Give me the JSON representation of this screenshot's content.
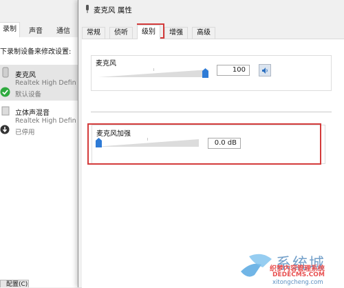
{
  "background_dialog": {
    "tabs": [
      {
        "label": "录制",
        "active": true
      },
      {
        "label": "声音",
        "active": false
      },
      {
        "label": "通信",
        "active": false
      }
    ],
    "instruction": "下录制设备来修改设置:",
    "devices": [
      {
        "name": "麦克风",
        "driver": "Realtek High Defin",
        "status": "默认设备",
        "selected": true,
        "status_icon": "check-icon"
      },
      {
        "name": "立体声混音",
        "driver": "Realtek High Defin",
        "status": "已停用",
        "selected": false,
        "status_icon": "disabled-arrow-icon"
      }
    ],
    "bottom_button": "配置(C)"
  },
  "properties_dialog": {
    "title": "麦克风 属性",
    "tabs": [
      {
        "label": "常规",
        "active": false
      },
      {
        "label": "侦听",
        "active": false
      },
      {
        "label": "级别",
        "active": true
      },
      {
        "label": "增强",
        "active": false
      },
      {
        "label": "高级",
        "active": false
      }
    ],
    "microphone": {
      "label": "麦克风",
      "value": "100",
      "level_fraction": 1.0
    },
    "boost": {
      "label": "麦克风加强",
      "value": "0.0 dB",
      "level_fraction": 0.0
    }
  },
  "colors": {
    "highlight": "#d33a3a",
    "slider_thumb": "#2e7bd6",
    "check": "#2eaa3e"
  },
  "watermark": {
    "site": "系统城",
    "cn": "织梦内容管理系统",
    "en": "DEDECMS.COM",
    "url": "xitongcheng.com"
  }
}
